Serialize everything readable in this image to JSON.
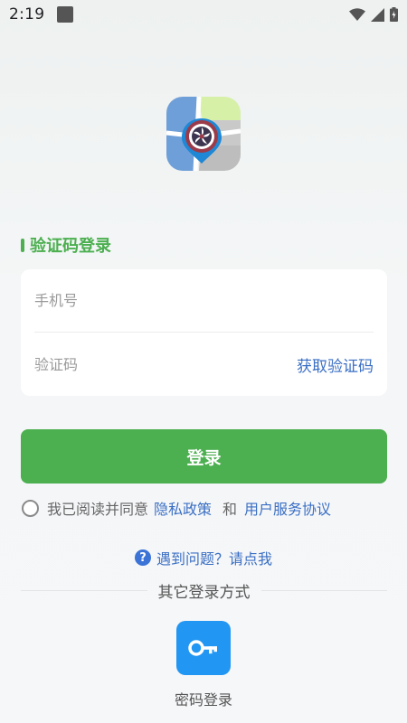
{
  "status_bar": {
    "time": "2:19",
    "icons": [
      "notification-square-icon",
      "wifi-icon",
      "cell-signal-icon",
      "battery-icon"
    ]
  },
  "logo": {
    "icon": "map-location-logo-icon"
  },
  "login_form": {
    "title": "验证码登录",
    "phone_placeholder": "手机号",
    "phone_value": "",
    "code_placeholder": "验证码",
    "code_value": "",
    "get_code_label": "获取验证码"
  },
  "login_button_label": "登录",
  "agreement": {
    "prefix": "我已阅读并同意",
    "privacy_label": "隐私政策",
    "and": "和",
    "terms_label": "用户服务协议",
    "checked": false
  },
  "help": {
    "icon_glyph": "?",
    "text": "遇到问题？请点我"
  },
  "other_login": {
    "divider_text": "其它登录方式",
    "password_login_label": "密码登录",
    "password_login_icon": "key-icon"
  },
  "colors": {
    "primary_green": "#4caf50",
    "link_blue": "#3a6fc4",
    "key_button_blue": "#2196f3",
    "help_icon_blue": "#3b73d6"
  }
}
